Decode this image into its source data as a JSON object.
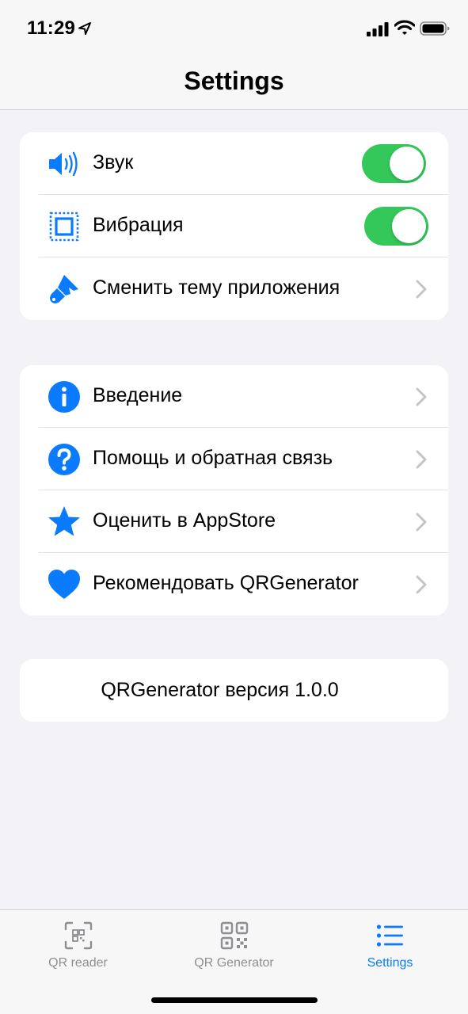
{
  "status_bar": {
    "time": "11:29",
    "icons": [
      "location-arrow-icon",
      "cellular-signal-icon",
      "wifi-icon",
      "battery-icon"
    ]
  },
  "nav": {
    "title": "Settings"
  },
  "accent_color": "#0a7aff",
  "toggle_on_color": "#34c759",
  "group1": {
    "sound": {
      "label": "Звук",
      "icon": "speaker-icon",
      "toggle_on": true
    },
    "vibration": {
      "label": "Вибрация",
      "icon": "vibration-icon",
      "toggle_on": true
    },
    "theme": {
      "label": "Сменить тему приложения",
      "icon": "paintbrush-icon"
    }
  },
  "group2": {
    "items": [
      {
        "label": "Введение",
        "icon": "info-icon"
      },
      {
        "label": "Помощь и обратная связь",
        "icon": "question-icon"
      },
      {
        "label": "Оценить в AppStore",
        "icon": "star-icon"
      },
      {
        "label": "Рекомендовать QRGenerator",
        "icon": "heart-icon"
      }
    ]
  },
  "version_text": "QRGenerator версия 1.0.0",
  "tabs": [
    {
      "label": "QR reader",
      "icon": "qr-scan-icon",
      "active": false
    },
    {
      "label": "QR Generator",
      "icon": "qr-code-icon",
      "active": false
    },
    {
      "label": "Settings",
      "icon": "list-icon",
      "active": true
    }
  ]
}
